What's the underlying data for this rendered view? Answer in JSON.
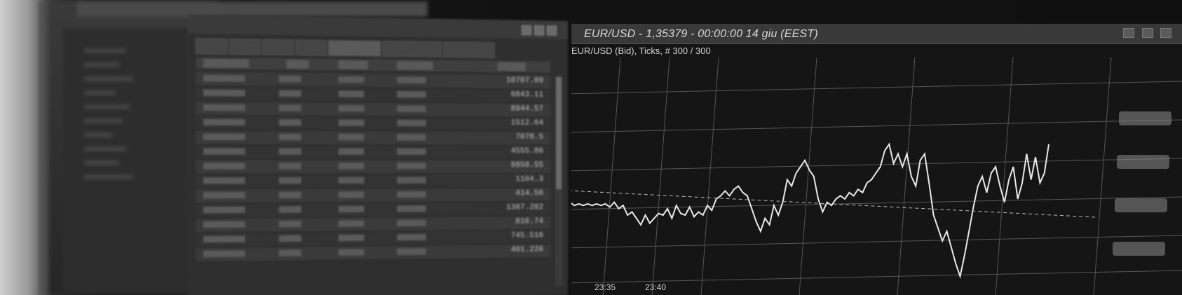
{
  "chart_window": {
    "title": "EUR/USD - 1,35379 - 00:00:00  14 giu (EEST)",
    "subtitle": "EUR/USD (Bid), Ticks, # 300 / 300"
  },
  "watchlist": {
    "values": [
      "10707.09",
      "6843.11",
      "8944.57",
      "1512.64",
      "7078.5",
      "4555.86",
      "8858.55",
      "1104.3",
      "414.56",
      "1387.282",
      "816.74",
      "745.516",
      "401.226"
    ]
  },
  "chart_data": {
    "type": "line",
    "title": "EUR/USD (Bid), Ticks, # 300 / 300",
    "xlabel": "",
    "ylabel": "",
    "x_ticks": [
      "23:35",
      "23:40"
    ],
    "reference_line": "dashed",
    "series": [
      {
        "values": [
          0.62,
          0.55,
          0.58,
          0.54,
          0.56,
          0.5,
          0.48,
          0.46,
          0.47,
          0.46,
          0.47,
          0.46,
          0.47,
          0.46,
          0.47,
          0.45,
          0.48,
          0.44,
          0.46,
          0.4,
          0.42,
          0.38,
          0.34,
          0.4,
          0.35,
          0.38,
          0.41,
          0.4,
          0.44,
          0.38,
          0.46,
          0.41,
          0.4,
          0.45,
          0.39,
          0.42,
          0.4,
          0.46,
          0.43,
          0.5,
          0.52,
          0.55,
          0.52,
          0.56,
          0.58,
          0.54,
          0.52,
          0.44,
          0.36,
          0.3,
          0.38,
          0.34,
          0.46,
          0.4,
          0.48,
          0.62,
          0.58,
          0.66,
          0.7,
          0.74,
          0.68,
          0.64,
          0.5,
          0.42,
          0.48,
          0.46,
          0.5,
          0.52,
          0.5,
          0.54,
          0.52,
          0.56,
          0.54,
          0.6,
          0.62,
          0.66,
          0.7,
          0.8,
          0.84,
          0.72,
          0.78,
          0.7,
          0.78,
          0.64,
          0.58,
          0.74,
          0.78,
          0.6,
          0.4,
          0.32,
          0.24,
          0.3,
          0.2,
          0.1,
          0.02,
          0.15,
          0.3,
          0.45,
          0.58,
          0.64,
          0.54,
          0.66,
          0.7,
          0.58,
          0.48,
          0.62,
          0.7,
          0.5,
          0.6,
          0.78,
          0.62,
          0.76,
          0.6,
          0.66,
          0.84
        ]
      }
    ],
    "reference_value": 0.56,
    "price_labels": 4
  },
  "colors": {
    "line": "#e8e8e8",
    "grid": "#555555",
    "background": "#151515"
  }
}
